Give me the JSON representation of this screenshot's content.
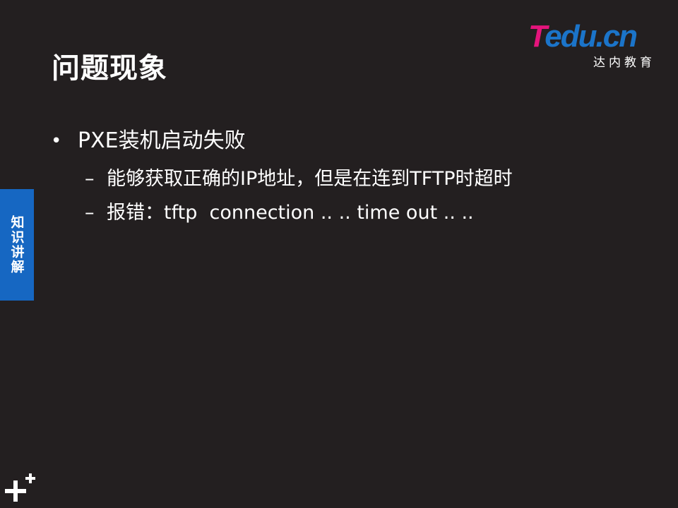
{
  "slide": {
    "title": "问题现象",
    "side_tab": "知识讲解",
    "logo": {
      "word_part1": "T",
      "word_part2": "edu.cn",
      "subtitle": "达内教育"
    },
    "bullets": [
      {
        "text": "PXE装机启动失败",
        "sub": [
          "能够获取正确的IP地址，但是在连到TFTP时超时",
          "报错：tftp  connection .. .. time out .. .."
        ]
      }
    ],
    "bullet_glyph": "•",
    "sub_glyph": "–"
  },
  "colors": {
    "background": "#231f20",
    "side_tab": "#1667c2",
    "logo_pink": "#e4147c",
    "logo_blue": "#1b74c9"
  },
  "icons": {
    "corner": "plus-plus-icon"
  }
}
